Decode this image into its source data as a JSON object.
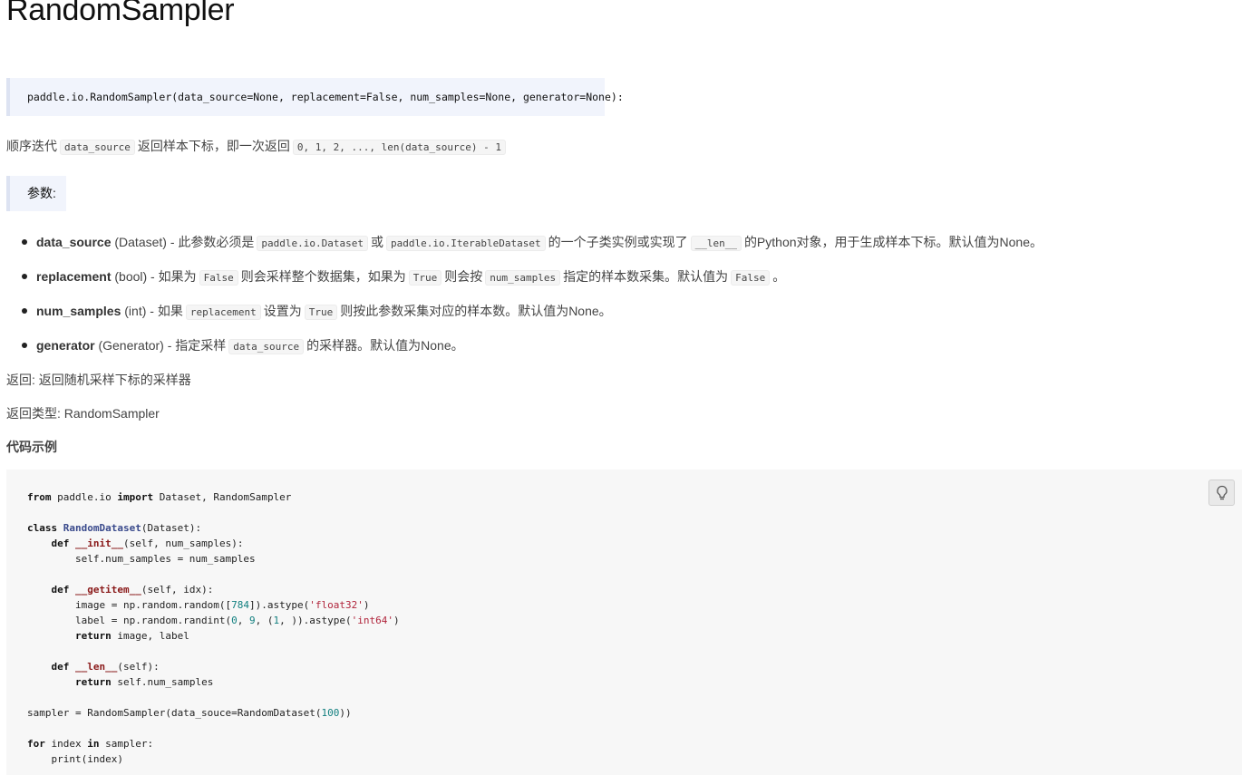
{
  "title": "RandomSampler",
  "signature": "paddle.io.RandomSampler(data_source=None, replacement=False, num_samples=None, generator=None):",
  "desc": {
    "t1": "顺序迭代",
    "c1": "data_source",
    "t2": "返回样本下标，即一次返回",
    "c2": "0, 1, 2, ..., len(data_source) - 1"
  },
  "params_label": "参数:",
  "params": [
    {
      "name": "data_source",
      "type": "(Dataset)",
      "t1": " - 此参数必须是",
      "c1": "paddle.io.Dataset",
      "t2": "或",
      "c2": "paddle.io.IterableDataset",
      "t3": "的一个子类实例或实现了",
      "c3": "__len__",
      "t4": "的Python对象，用于生成样本下标。默认值为None。"
    },
    {
      "name": "replacement",
      "type": "(bool)",
      "t1": " - 如果为",
      "c1": "False",
      "t2": "则会采样整个数据集，如果为",
      "c2": "True",
      "t3": "则会按",
      "c3": "num_samples",
      "t4": "指定的样本数采集。默认值为",
      "c4": "False",
      "t5": "。"
    },
    {
      "name": "num_samples",
      "type": "(int)",
      "t1": " - 如果",
      "c1": "replacement",
      "t2": "设置为",
      "c2": "True",
      "t3": "则按此参数采集对应的样本数。默认值为None。"
    },
    {
      "name": "generator",
      "type": "(Generator)",
      "t1": " - 指定采样",
      "c1": "data_source",
      "t2": "的采样器。默认值为None。"
    }
  ],
  "returns": "返回: 返回随机采样下标的采样器",
  "return_type": "返回类型: RandomSampler",
  "code_heading": "代码示例",
  "code": {
    "l1": {
      "k1": "from",
      "a": " paddle.io ",
      "k2": "import",
      "b": " Dataset, RandomSampler"
    },
    "l3": {
      "k": "class",
      "name": "RandomDataset",
      "rest": "(Dataset):"
    },
    "l4": {
      "indent": "    ",
      "k": "def",
      "name": "__init__",
      "rest": "(self, num_samples):"
    },
    "l5": "        self.num_samples = num_samples",
    "l7": {
      "indent": "    ",
      "k": "def",
      "name": "__getitem__",
      "rest": "(self, idx):"
    },
    "l8": {
      "a": "        image = np.random.random([",
      "n": "784",
      "b": "]).astype(",
      "s": "'float32'",
      "c": ")"
    },
    "l9": {
      "a": "        label = np.random.randint(",
      "n1": "0",
      "b": ", ",
      "n2": "9",
      "c": ", (",
      "n3": "1",
      "d": ", )).astype(",
      "s": "'int64'",
      "e": ")"
    },
    "l10": {
      "indent": "        ",
      "k": "return",
      "rest": " image, label"
    },
    "l12": {
      "indent": "    ",
      "k": "def",
      "name": "__len__",
      "rest": "(self):"
    },
    "l13": {
      "indent": "        ",
      "k": "return",
      "rest": " self.num_samples"
    },
    "l15": {
      "a": "sampler = RandomSampler(data_souce=RandomDataset(",
      "n": "100",
      "b": "))"
    },
    "l17": {
      "k1": "for",
      "a": " index ",
      "k2": "in",
      "b": " sampler:"
    },
    "l18": "    print(index)"
  }
}
